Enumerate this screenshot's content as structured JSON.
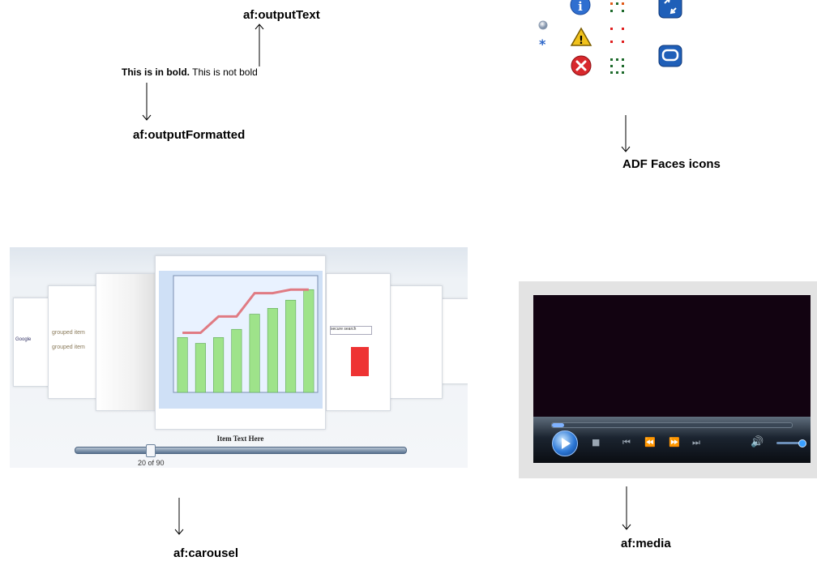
{
  "labels": {
    "output_text": "af:outputText",
    "output_formatted": "af:outputFormatted",
    "adf_icons": "ADF Faces icons",
    "carousel": "af:carousel",
    "media": "af:media"
  },
  "sample": {
    "bold_text": "This is in bold.",
    "plain_text": " This is not bold"
  },
  "icons": [
    "small-ball-icon",
    "asterisk-icon",
    "info-icon",
    "warning-icon",
    "error-icon",
    "dotted-grid-icon",
    "expand-icon",
    "rounded-box-icon"
  ],
  "carousel": {
    "item_text": "Item Text Here",
    "position": "20 of 90",
    "position_value": 20,
    "total": 90,
    "card_texts": {
      "google": "Google",
      "grouped_1": "grouped item",
      "grouped_2": "grouped item",
      "secure_search": "secure search"
    },
    "chart_bar_values": [
      470,
      420,
      470,
      540,
      670,
      720,
      790,
      880
    ],
    "chart_line_values": [
      510,
      510,
      650,
      650,
      850,
      850,
      880,
      880
    ]
  },
  "media": {
    "seek_fraction": 0.05,
    "volume_fraction": 0.9
  },
  "colors": {
    "info_blue": "#2f6fd0",
    "warning_yellow": "#f1c21c",
    "error_red": "#d8282c",
    "bar_green": "#9ee38a",
    "line_red": "#e07b83",
    "media_screen": "#120311"
  }
}
